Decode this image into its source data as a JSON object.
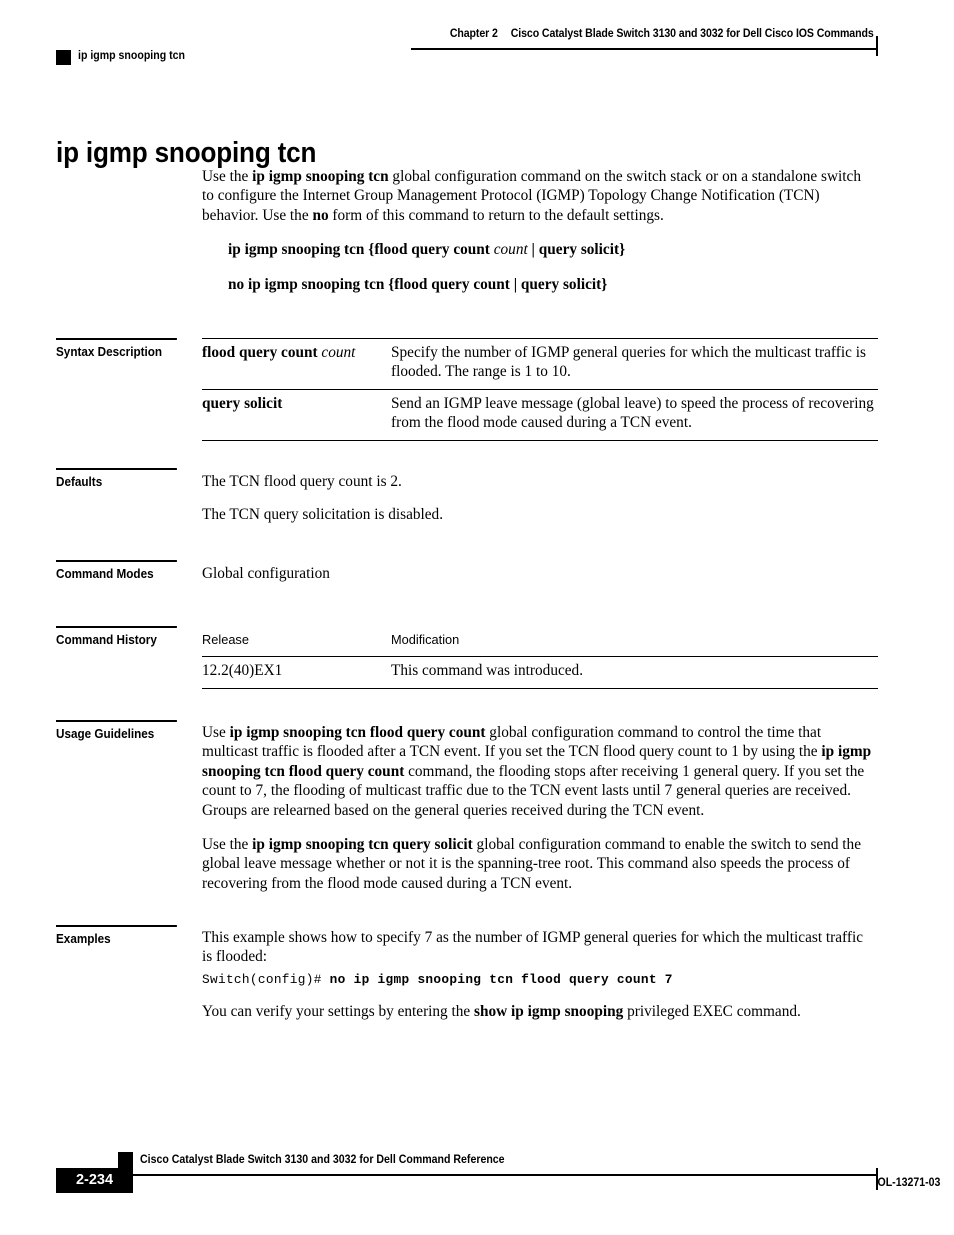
{
  "header": {
    "chapter": "Chapter 2",
    "book_title": "Cisco Catalyst Blade Switch 3130 and 3032 for Dell Cisco IOS Commands",
    "running_head": "ip igmp snooping tcn"
  },
  "title": "ip igmp snooping tcn",
  "intro": {
    "p1_a": "Use the ",
    "p1_b": "ip igmp snooping tcn",
    "p1_c": " global configuration command on the switch stack or on a standalone switch to configure the Internet Group Management Protocol (IGMP) Topology Change Notification (TCN) behavior. Use the ",
    "p1_d": "no",
    "p1_e": " form of this command to return to the default settings."
  },
  "syntax": {
    "line1_cmd": "ip igmp snooping tcn",
    "line1_open": " {",
    "line1_kw1": "flood query count",
    "line1_arg": "count",
    "line1_sep": " | ",
    "line1_kw2": "query solicit",
    "line1_close": "}",
    "line2_cmd": "no ip igmp snooping tcn",
    "line2_open": " {",
    "line2_kw1": "flood query count",
    "line2_sep": " | ",
    "line2_kw2": "query solicit",
    "line2_close": "}"
  },
  "sections": {
    "syntax_description": "Syntax Description",
    "defaults": "Defaults",
    "command_modes": "Command Modes",
    "command_history": "Command History",
    "usage_guidelines": "Usage Guidelines",
    "examples": "Examples"
  },
  "syntax_table": {
    "rows": [
      {
        "term_bold": "flood query count ",
        "term_italic": "count",
        "desc": "Specify the number of IGMP general queries for which the multicast traffic is flooded. The range is 1 to 10."
      },
      {
        "term_bold": "query solicit",
        "term_italic": "",
        "desc": "Send an IGMP leave message (global leave) to speed the process of recovering from the flood mode caused during a TCN event."
      }
    ]
  },
  "defaults": {
    "p1": "The TCN flood query count is 2.",
    "p2": "The TCN query solicitation is disabled."
  },
  "command_modes": {
    "value": "Global configuration"
  },
  "command_history": {
    "headers": {
      "release": "Release",
      "modification": "Modification"
    },
    "rows": [
      {
        "release": "12.2(40)EX1",
        "modification": "This command was introduced."
      }
    ]
  },
  "usage_guidelines": {
    "p1_a": "Use ",
    "p1_b": "ip igmp snooping tcn flood query count",
    "p1_c": " global configuration command to control the time that multicast traffic is flooded after a TCN event. If you set the TCN flood query count to 1 by using the ",
    "p1_d": "ip igmp snooping tcn flood query count",
    "p1_e": " command, the flooding stops after receiving 1 general query. If you set the count to 7, the flooding of multicast traffic due to the TCN event lasts until 7 general queries are received. Groups are relearned based on the general queries received during the TCN event.",
    "p2_a": "Use the ",
    "p2_b": "ip igmp snooping tcn query solicit",
    "p2_c": " global configuration command to enable the switch to send the global leave message whether or not it is the spanning-tree root. This command also speeds the process of recovering from the flood mode caused during a TCN event."
  },
  "examples": {
    "p1": "This example shows how to specify 7 as the number of IGMP general queries for which the multicast traffic is flooded:",
    "cli_prompt": "Switch(config)# ",
    "cli_command": "no ip igmp snooping tcn flood query count 7",
    "p2_a": "You can verify your settings by entering the ",
    "p2_b": "show ip igmp snooping",
    "p2_c": " privileged EXEC command."
  },
  "footer": {
    "marker_book_title": "Cisco Catalyst Blade Switch 3130 and 3032 for Dell Command Reference",
    "page_number": "2-234",
    "doc_id": "OL-13271-03"
  }
}
